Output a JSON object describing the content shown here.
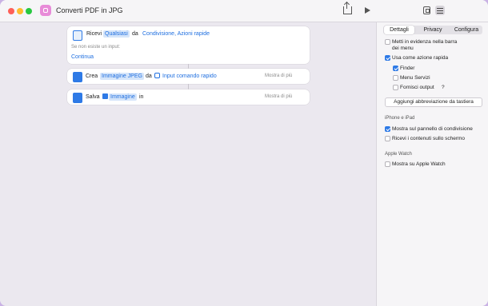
{
  "window": {
    "title": "Converti PDF in JPG"
  },
  "steps": [
    {
      "verb": "Ricevi",
      "input_type": "Qualsiasi",
      "from_label": "da",
      "source": "Condivisione, Azioni rapide",
      "no_input_label": "Se non esiste un input:",
      "no_input_action": "Continua"
    },
    {
      "verb": "Crea",
      "object": "Immagine JPEG",
      "from_label": "da",
      "source": "Input comando rapido",
      "more": "Mostra di più"
    },
    {
      "verb": "Salva",
      "object": "Immagine",
      "in_label": "in",
      "more": "Mostra di più"
    }
  ],
  "sidebar": {
    "tabs": [
      "Dettagli",
      "Privacy",
      "Configura"
    ],
    "active_tab": "Dettagli",
    "options": {
      "menu_bar": {
        "label_line1": "Metti in evidenza nella barra",
        "label_line2": "dei menu",
        "checked": false
      },
      "quick_action": {
        "label": "Usa come azione rapida",
        "checked": true
      },
      "finder": {
        "label": "Finder",
        "checked": true
      },
      "services": {
        "label": "Menu Servizi",
        "checked": false
      },
      "output": {
        "label": "Fornisci output",
        "checked": false,
        "help": "?"
      }
    },
    "shortcut_button": "Aggiungi abbreviazione da tastiera",
    "iphone_section": "iPhone e iPad",
    "share_sheet": {
      "label": "Mostra sul pannello di condivisione",
      "checked": true
    },
    "receive_screen": {
      "label": "Ricevi i contenuti sullo schermo",
      "checked": false
    },
    "watch_section": "Apple Watch",
    "watch_show": {
      "label": "Mostra su Apple Watch",
      "checked": false
    }
  },
  "colors": {
    "accent": "#2e7ae6",
    "app_icon": "#e88bd8"
  }
}
